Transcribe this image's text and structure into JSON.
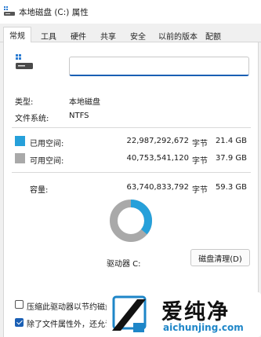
{
  "window": {
    "title": "本地磁盘 (C:) 属性"
  },
  "tabs": [
    {
      "label": "常规",
      "active": true
    },
    {
      "label": "工具",
      "active": false
    },
    {
      "label": "硬件",
      "active": false
    },
    {
      "label": "共享",
      "active": false
    },
    {
      "label": "安全",
      "active": false
    },
    {
      "label": "以前的版本",
      "active": false
    },
    {
      "label": "配额",
      "active": false
    }
  ],
  "general": {
    "name_value": "",
    "type_label": "类型:",
    "type_value": "本地磁盘",
    "fs_label": "文件系统:",
    "fs_value": "NTFS",
    "used": {
      "label": "已用空间:",
      "bytes": "22,987,292,672",
      "unit": "字节",
      "size": "21.4 GB",
      "color": "#26a0da"
    },
    "free": {
      "label": "可用空间:",
      "bytes": "40,753,541,120",
      "unit": "字节",
      "size": "37.9 GB",
      "color": "#a9a9a9"
    },
    "capacity": {
      "label": "容量:",
      "bytes": "63,740,833,792",
      "unit": "字节",
      "size": "59.3 GB"
    },
    "drive_label": "驱动器 C:",
    "cleanup_button": "磁盘清理(D)",
    "usage_fraction": 0.3606
  },
  "options": {
    "compress": {
      "label": "压缩此驱动器以节约磁盘",
      "checked": false
    },
    "index": {
      "label": "除了文件属性外，还允许",
      "checked": true
    }
  },
  "watermark": {
    "cn": "爱纯净",
    "en": "aichunjing.com"
  },
  "colors": {
    "accent": "#1a5fb4",
    "used": "#26a0da",
    "free": "#a9a9a9"
  }
}
